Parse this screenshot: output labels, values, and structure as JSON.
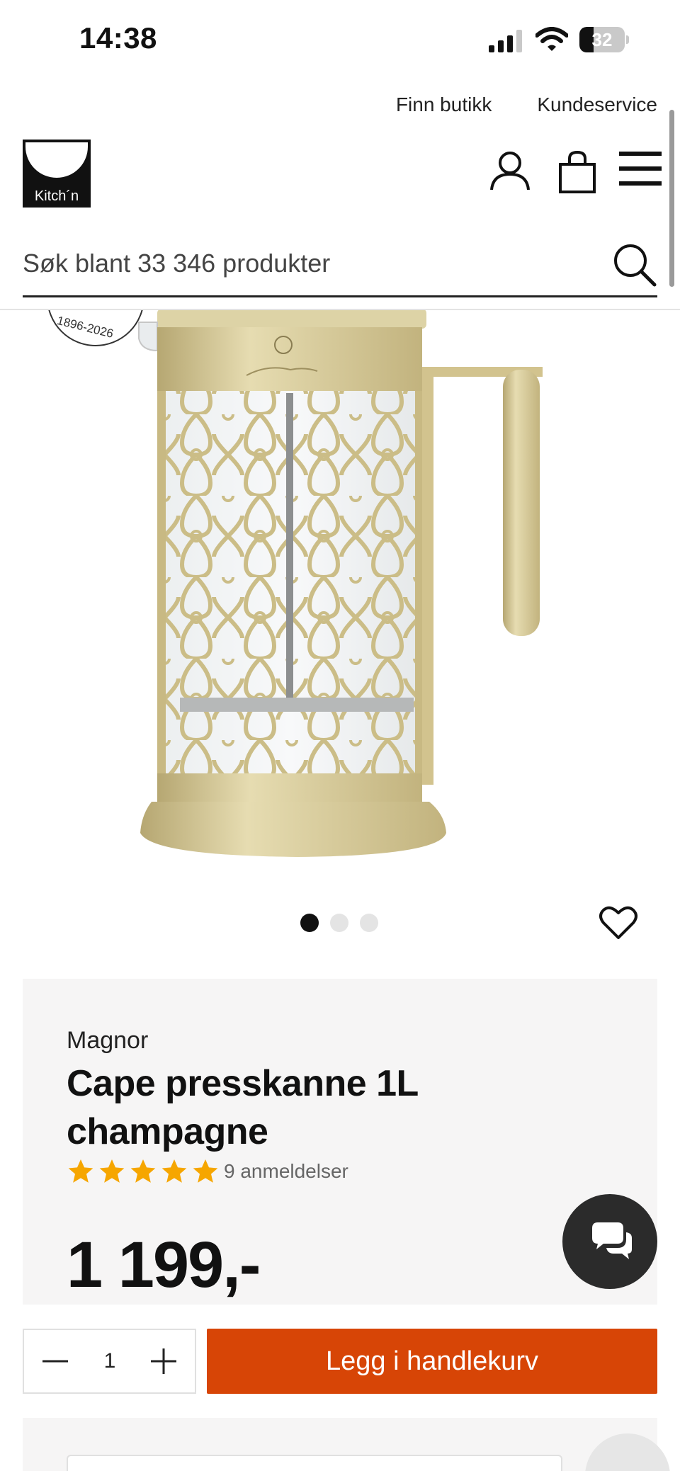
{
  "status_bar": {
    "time": "14:38",
    "battery_level": "32",
    "battery_fraction": 0.32
  },
  "header": {
    "links": [
      "Finn butikk",
      "Kundeservice"
    ],
    "logo_text": "Kitch´n",
    "icons": [
      "user-icon",
      "shopping-bag-icon",
      "menu-icon"
    ]
  },
  "search": {
    "placeholder": "Søk blant 33 346 produkter",
    "icon": "search-icon"
  },
  "product_image": {
    "badge_text": "1896-2026",
    "carousel": {
      "dot_count": 3,
      "active_index": 0
    },
    "favorite_icon": "heart-icon"
  },
  "product": {
    "brand": "Magnor",
    "title": "Cape presskanne 1L champagne",
    "rating": 5,
    "rating_max": 5,
    "reviews": "9 anmeldelser",
    "price": "1 199,-"
  },
  "purchase": {
    "quantity": "1",
    "add_to_cart": "Legg i handlekurv"
  },
  "chat": {
    "icon": "chat-icon"
  },
  "colors": {
    "accent": "#d74506",
    "star": "#f6a600",
    "card_bg": "#f6f5f5",
    "product_gold": "#d2c38e"
  }
}
